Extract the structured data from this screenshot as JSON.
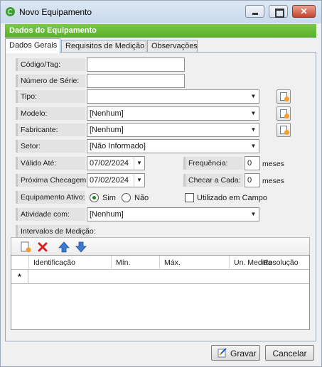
{
  "window": {
    "title": "Novo Equipamento",
    "close_glyph": "✕"
  },
  "section_title": "Dados do Equipamento",
  "tabs": [
    "Dados Gerais",
    "Requisitos de Medição",
    "Observações"
  ],
  "form": {
    "codigo_label": "Código/Tag:",
    "codigo_value": "",
    "serie_label": "Número de Série:",
    "serie_value": "",
    "tipo_label": "Tipo:",
    "tipo_value": "",
    "modelo_label": "Modelo:",
    "modelo_value": "[Nenhum]",
    "fabricante_label": "Fabricante:",
    "fabricante_value": "[Nenhum]",
    "setor_label": "Setor:",
    "setor_value": "[Não Informado]",
    "valido_label": "Válido Até:",
    "valido_value": "07/02/2024",
    "frequencia_label": "Frequência:",
    "frequencia_value": "0",
    "frequencia_unit": "meses",
    "proxima_label": "Próxima Checagem:",
    "proxima_value": "07/02/2024",
    "checar_label": "Checar a Cada:",
    "checar_value": "0",
    "checar_unit": "meses",
    "ativo_label": "Equipamento Ativo:",
    "ativo_sim": "Sim",
    "ativo_nao": "Não",
    "ativo_selected": "Sim",
    "campo_label": "Utilizado em Campo",
    "atividade_label": "Atividade com:",
    "atividade_value": "[Nenhum]",
    "intervalos_label": "Intervalos de Medição:"
  },
  "grid": {
    "columns": [
      "Identificação",
      "Mín.",
      "Máx.",
      "Un. Medida",
      "Resolução"
    ],
    "new_row_marker": "*"
  },
  "buttons": {
    "gravar": "Gravar",
    "cancelar": "Cancelar"
  },
  "icons": {
    "dropdown": "▼",
    "toolbar": [
      "add-row-icon",
      "delete-row-icon",
      "move-up-icon",
      "move-down-icon"
    ]
  }
}
